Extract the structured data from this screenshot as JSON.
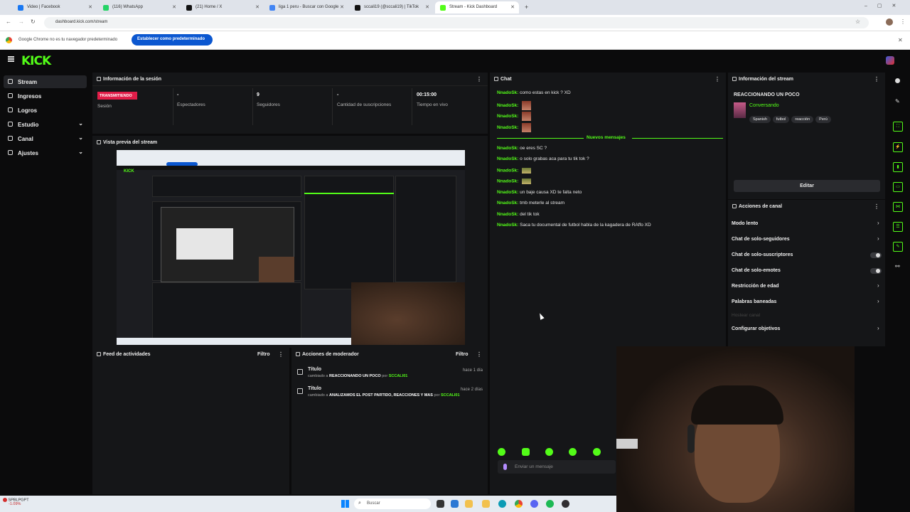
{
  "browser": {
    "tabs": [
      {
        "title": "Video | Facebook",
        "color": "#1877f2"
      },
      {
        "title": "(116) WhatsApp",
        "color": "#25d366"
      },
      {
        "title": "(21) Home / X",
        "color": "#111111"
      },
      {
        "title": "liga 1 peru - Buscar con Google",
        "color": "#4285f4"
      },
      {
        "title": "sccali19 (@sccali19) | TikTok",
        "color": "#111111"
      },
      {
        "title": "Stream - Kick Dashboard",
        "color": "#53fc18"
      }
    ],
    "url": "dashboard.kick.com/stream",
    "infobar_message": "Google Chrome no es tu navegador predeterminado",
    "set_default_label": "Establecer como predeterminado"
  },
  "kick": {
    "logo": "KICK",
    "sidebar": [
      {
        "label": "Stream",
        "active": true,
        "chevron": false
      },
      {
        "label": "Ingresos",
        "active": false,
        "chevron": false
      },
      {
        "label": "Logros",
        "active": false,
        "chevron": false
      },
      {
        "label": "Estudio",
        "active": false,
        "chevron": true
      },
      {
        "label": "Canal",
        "active": false,
        "chevron": true
      },
      {
        "label": "Ajustes",
        "active": false,
        "chevron": true
      }
    ]
  },
  "session": {
    "title": "Información de la sesión",
    "live_badge": "TRANSMITIENDO",
    "cells": [
      {
        "value": "",
        "label": "Sesión"
      },
      {
        "value": "-",
        "label": "Espectadores"
      },
      {
        "value": "9",
        "label": "Seguidores"
      },
      {
        "value": "-",
        "label": "Cantidad de suscripciones"
      },
      {
        "value": "00:15:00",
        "label": "Tiempo en vivo"
      }
    ]
  },
  "preview": {
    "title": "Vista previa del stream"
  },
  "activity": {
    "title": "Feed de actividades",
    "filter": "Filtro"
  },
  "moderator": {
    "title": "Acciones de moderador",
    "filter": "Filtro",
    "items": [
      {
        "title": "Título",
        "prefix": "cambiado a",
        "value": "REACCIONANDO UN POCO",
        "by": "por",
        "user": "SCCALI01",
        "time": "hace 1 día"
      },
      {
        "title": "Título",
        "prefix": "cambiado a",
        "value": "ANALIZAMOS EL POST PARTIDO, REACCIONES Y MAS",
        "by": "por",
        "user": "SCCALI01",
        "time": "hace 2 días"
      }
    ]
  },
  "chat": {
    "title": "Chat",
    "new_messages": "Nuevos mensajes",
    "input_placeholder": "Enviar un mensaje",
    "messages_old": [
      {
        "user": "NnadoSk:",
        "text": "como estas en kick ? XD",
        "emote": ""
      },
      {
        "user": "NnadoSk:",
        "text": "",
        "emote": "face"
      },
      {
        "user": "NnadoSk:",
        "text": "",
        "emote": "face"
      },
      {
        "user": "NnadoSk:",
        "text": "",
        "emote": "face"
      }
    ],
    "messages_new": [
      {
        "user": "NnadoSk:",
        "text": "oe eres SC ?",
        "emote": ""
      },
      {
        "user": "NnadoSk:",
        "text": "o solo grabas aca para tu tik tok ?",
        "emote": ""
      },
      {
        "user": "NnadoSk:",
        "text": "",
        "emote": "small"
      },
      {
        "user": "NnadoSk:",
        "text": "",
        "emote": "small"
      },
      {
        "user": "NnadoSk:",
        "text": "un baje causa XD te falta neto",
        "emote": ""
      },
      {
        "user": "NnadoSk:",
        "text": "tmb meterle al stream",
        "emote": ""
      },
      {
        "user": "NnadoSk:",
        "text": "del tik tok",
        "emote": ""
      },
      {
        "user": "NnadoSk:",
        "text": "Saca tu documental de futbol habla de la kagadera de RAffo XD",
        "emote": ""
      }
    ]
  },
  "stream_info": {
    "title": "Información del stream",
    "stream_title": "REACCIONANDO UN POCO",
    "category": "Conversando",
    "tags": [
      "Spanish",
      "futbol",
      "reacción",
      "Perú"
    ],
    "edit_label": "Editar"
  },
  "channel_actions": {
    "title": "Acciones de canal",
    "items": [
      {
        "label": "Modo lento",
        "control": "chevron"
      },
      {
        "label": "Chat de solo-seguidores",
        "control": "chevron"
      },
      {
        "label": "Chat de solo-suscriptores",
        "control": "toggle"
      },
      {
        "label": "Chat de solo-emotes",
        "control": "toggle"
      },
      {
        "label": "Restricción de edad",
        "control": "chevron"
      },
      {
        "label": "Palabras baneadas",
        "control": "chevron"
      },
      {
        "label": "Hostear canal",
        "control": "disabled"
      },
      {
        "label": "Configurar objetivos",
        "control": "chevron"
      }
    ]
  },
  "taskbar": {
    "ticker": "SPBLPGPT",
    "ticker_change": "-1.09%",
    "search_placeholder": "Buscar"
  }
}
